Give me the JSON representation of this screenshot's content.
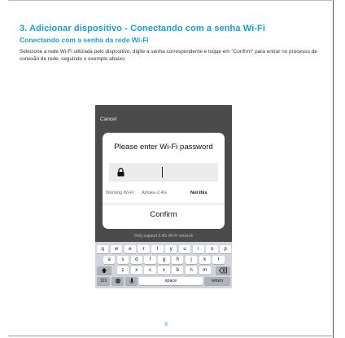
{
  "heading": "3. Adicionar dispositivo - Conectando com a senha Wi-Fi",
  "subheading": "Conectando com a senha da rede Wi-Fi",
  "paragraph": "Selecione a rede Wi-Fi utilizada pelo dispositivo, digite a senha correspondente e toque em \"Confirm\" para entrar no processo de conexão de rede, seguindo o exemplo abaixo.",
  "phone": {
    "cancel": "Cancel",
    "dialog_title": "Please enter Wi-Fi password",
    "working_wifi_label": "Working Wi-Fi:",
    "wifi_name": "Airtake-2.4G",
    "not_this": "Not this",
    "confirm": "Confirm",
    "only_support": "Only support 2.4G Wi-Fi network",
    "keyboard": {
      "row1": [
        "q",
        "w",
        "e",
        "r",
        "t",
        "y",
        "u",
        "i",
        "o",
        "p"
      ],
      "row2": [
        "a",
        "s",
        "d",
        "f",
        "g",
        "h",
        "j",
        "k",
        "l"
      ],
      "row3": [
        "z",
        "x",
        "c",
        "v",
        "b",
        "n",
        "m"
      ],
      "numbers_key": "123",
      "space_key": "space",
      "return_key": "return",
      "icons": [
        "shift-icon",
        "backspace-icon",
        "globe-icon",
        "microphone-icon",
        "lock-icon"
      ]
    }
  },
  "page_number": "9",
  "colors": {
    "accent": "#1a9fd6",
    "phone_bg": "#4b4b4b",
    "keyboard_bg": "#d2d5db"
  }
}
